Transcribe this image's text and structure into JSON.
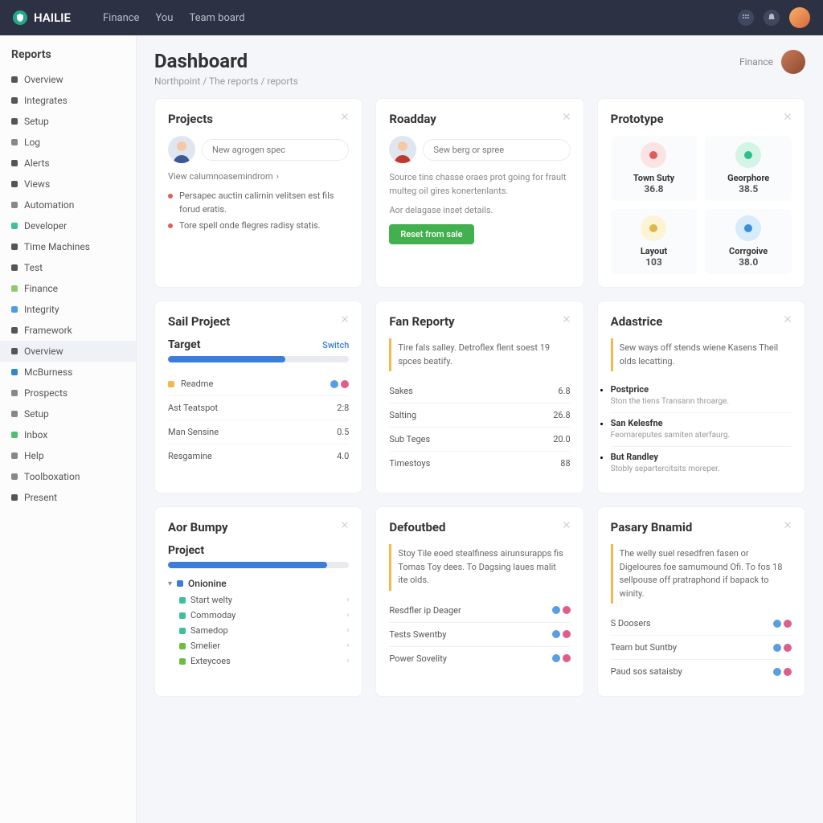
{
  "brand": "HAILIE",
  "topnav": [
    "Finance",
    "You",
    "Team board"
  ],
  "sidebar": {
    "heading": "Reports",
    "items": [
      {
        "label": "Overview",
        "color": "#555"
      },
      {
        "label": "Integrates",
        "color": "#555"
      },
      {
        "label": "Setup",
        "color": "#555"
      },
      {
        "label": "Log",
        "color": "#888"
      },
      {
        "label": "Alerts",
        "color": "#555"
      },
      {
        "label": "Views",
        "color": "#555"
      },
      {
        "label": "Automation",
        "color": "#888"
      },
      {
        "label": "Developer",
        "color": "#3fbf9b"
      },
      {
        "label": "Time Machines",
        "color": "#555"
      },
      {
        "label": "Test",
        "color": "#555"
      },
      {
        "label": "Finance",
        "color": "#8fc96e"
      },
      {
        "label": "Integrity",
        "color": "#4a9de0"
      },
      {
        "label": "Framework",
        "color": "#555"
      },
      {
        "label": "Overview",
        "color": "#555",
        "active": true
      },
      {
        "label": "McBurness",
        "color": "#2a8ac9"
      },
      {
        "label": "Prospects",
        "color": "#888"
      },
      {
        "label": "Setup",
        "color": "#888"
      },
      {
        "label": "Inbox",
        "color": "#4fbf71"
      },
      {
        "label": "Help",
        "color": "#888"
      },
      {
        "label": "Toolboxation",
        "color": "#888"
      },
      {
        "label": "Present",
        "color": "#555"
      }
    ]
  },
  "page": {
    "title": "Dashboard",
    "breadcrumb": "Northpoint / The reports / reports",
    "action": "Finance"
  },
  "cards": {
    "r1c1": {
      "title": "Projects",
      "placeholder": "New agrogen spec",
      "link": "View calumnoasemindrom",
      "items": [
        {
          "color": "#e05c5c",
          "text": "Persapec auctin calirnin velitsen est fils forud eratis."
        },
        {
          "color": "#e05c5c",
          "text": "Tore spell onde flegres radisy statis."
        }
      ]
    },
    "r1c2": {
      "title": "Roadday",
      "placeholder": "Sew berg or spree",
      "text1": "Source tins chasse oraes prot going for frault multeg oil gires konertenlants.",
      "text2": "Aor delagase inset details.",
      "button": "Reset from sale"
    },
    "r1c3": {
      "title": "Prototype",
      "stats": [
        {
          "icon_color": "#fce4e4",
          "dot": "#e05c5c",
          "label": "Town Suty",
          "value": "36.8"
        },
        {
          "icon_color": "#d4f4e6",
          "dot": "#2fbf8f",
          "label": "Georphore",
          "value": "38.5"
        },
        {
          "icon_color": "#fdf3d6",
          "dot": "#e0b84a",
          "label": "Layout",
          "value": "103"
        },
        {
          "icon_color": "#d6ecfa",
          "dot": "#3b8de0",
          "label": "Corrgoive",
          "value": "38.0"
        }
      ]
    },
    "r2c1": {
      "title": "Sail Project",
      "section": "Target",
      "section_link": "Switch",
      "progress": 65,
      "rows": [
        {
          "label": "Readme",
          "color": "#f5b84d"
        },
        {
          "label": "Ast Teatspot",
          "value": "2:8"
        },
        {
          "label": "Man Sensine",
          "value": "0.5"
        },
        {
          "label": "Resgamine",
          "value": "4.0"
        }
      ]
    },
    "r2c2": {
      "title": "Fan Reporty",
      "note": "Tire fals salley. Detroflex flent soest 19 spces beatify.",
      "rows": [
        {
          "label": "Sakes",
          "value": "6.8"
        },
        {
          "label": "Salting",
          "value": "26.8"
        },
        {
          "label": "Sub Teges",
          "value": "20.0"
        },
        {
          "label": "Timestoys",
          "value": "88"
        }
      ]
    },
    "r2c3": {
      "title": "Adastrice",
      "note": "Sew ways off stends wiene Kasens Theil olds lecatting.",
      "updates": [
        {
          "title": "Postprice",
          "sub": "Ston the tiens Transann throarge."
        },
        {
          "title": "San Kelesfne",
          "sub": "Feomareputes samiten aterfaurg."
        },
        {
          "title": "But Randley",
          "sub": "Stobly separtercitsits moreper."
        }
      ]
    },
    "r3c1": {
      "title": "Aor Bumpy",
      "section": "Project",
      "progress": 88,
      "tree_root": "Onionine",
      "tree": [
        {
          "label": "Start welty",
          "color": "#3fbf9b"
        },
        {
          "label": "Commoday",
          "color": "#3fbf9b"
        },
        {
          "label": "Samedop",
          "color": "#3fbf9b"
        },
        {
          "label": "Smelier",
          "color": "#6bbf3f"
        },
        {
          "label": "Exteycoes",
          "color": "#6bbf3f"
        }
      ]
    },
    "r3c2": {
      "title": "Defoutbed",
      "note": "Stoy Tile eoed stealfiness airunsurapps fis Tomas Toy dees. To Dagsing laues malit ite olds.",
      "rows": [
        {
          "label": "Resdfler ip Deager"
        },
        {
          "label": "Tests Swentby"
        },
        {
          "label": "Power Sovelity"
        }
      ]
    },
    "r3c3": {
      "title": "Pasary Bnamid",
      "note": "The welly suel resedfren fasen or Digeloures foe samumound Ofi. To fos 18 sellpouse off pratraphond if bapack to winity.",
      "rows": [
        {
          "label": "S Doosers"
        },
        {
          "label": "Team but Suntby"
        },
        {
          "label": "Paud sos sataisby"
        }
      ]
    }
  }
}
